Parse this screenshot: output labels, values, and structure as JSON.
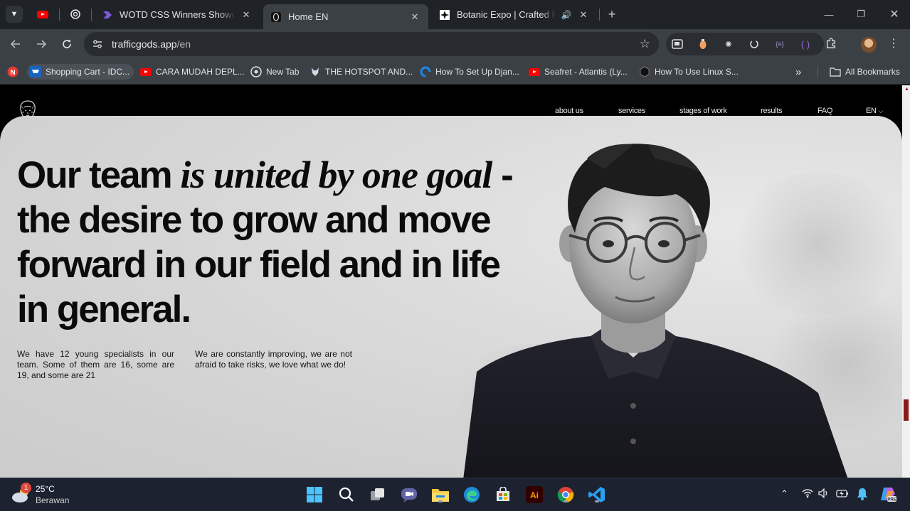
{
  "browser": {
    "tabs": [
      {
        "title": "WOTD CSS Winners Showcase -",
        "icon": "css-winners-icon",
        "active": false
      },
      {
        "title": "Home EN",
        "icon": "traffic-gods-icon",
        "active": true
      },
      {
        "title": "Botanic Expo | Crafted Futur",
        "icon": "botanic-icon",
        "active": false,
        "audio": true
      }
    ],
    "url_host": "trafficgods.app",
    "url_path": "/en",
    "bookmarks": [
      {
        "label": "Shopping Cart - IDC...",
        "icon": "cart-icon"
      },
      {
        "label": "CARA MUDAH DEPL...",
        "icon": "youtube-icon"
      },
      {
        "label": "New Tab",
        "icon": "chrome-icon"
      },
      {
        "label": "THE HOTSPOT AND...",
        "icon": "wolf-icon"
      },
      {
        "label": "How To Set Up Djan...",
        "icon": "digitalocean-icon"
      },
      {
        "label": "Seafret - Atlantis (Ly...",
        "icon": "youtube-icon"
      },
      {
        "label": "How To Use Linux S...",
        "icon": "hexagon-icon"
      }
    ],
    "all_bookmarks": "All Bookmarks"
  },
  "site": {
    "nav": [
      "about us",
      "services",
      "stages of work",
      "results",
      "FAQ"
    ],
    "lang": "EN",
    "headline_1": "Our team ",
    "headline_italic": "is united  by one goal",
    "headline_2": " - the desire to grow and move forward in our field and in life in general.",
    "para_left": "We have 12 young specialists in our team. Some of them are 16, some are 19, and some are 21",
    "para_right": "We are constantly improving, we are not afraid to take risks, we love what we do!"
  },
  "taskbar": {
    "temperature": "25°C",
    "weather": "Berawan",
    "weather_badge": "1"
  }
}
